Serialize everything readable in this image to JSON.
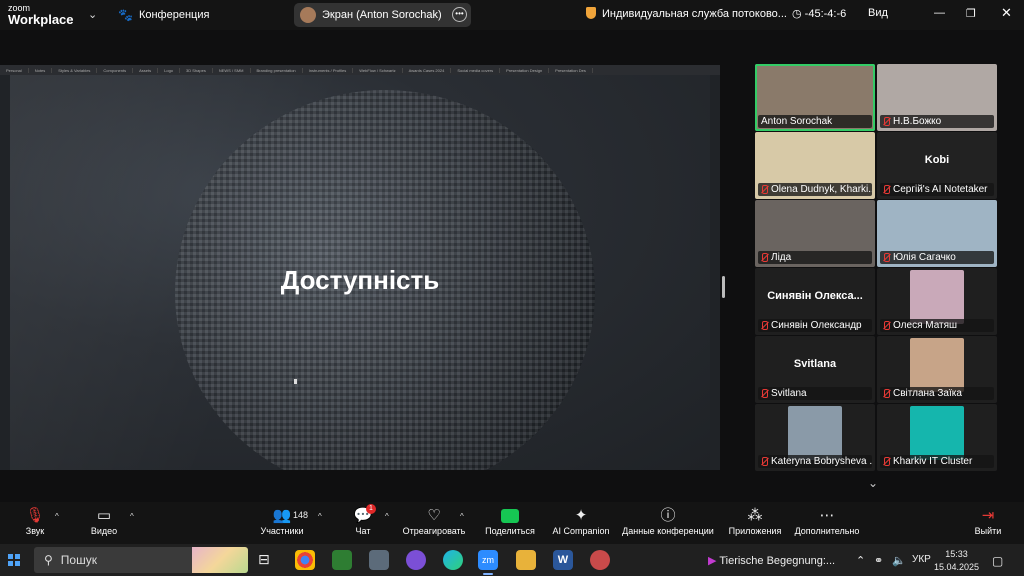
{
  "app": {
    "logo_line1": "zoom",
    "logo_line2": "Workplace",
    "meeting_label": "Конференция"
  },
  "share_indicator": {
    "label": "Экран (Anton Sorochak)"
  },
  "topbar_right": {
    "vpn_label": "Индивидуальная служба потоково...",
    "signal": "-45:-4:-6",
    "view_label": "Вид"
  },
  "browser_tabs": [
    "Personal",
    "Notes",
    "Styles & Variables",
    "Components",
    "Assets",
    "Logo",
    "3D Shapes",
    "NEWS / SMM",
    "Branding presentation",
    "Instruments / Profiles",
    "WebFlow / Schwartz",
    "Awards Cases 2024",
    "Social media covers",
    "Presentation Design",
    "Presentation Des"
  ],
  "slide": {
    "title": "Доступність"
  },
  "participants": [
    {
      "name": "Anton Sorochak",
      "active": true,
      "muted": false,
      "bg": "#8a7a6a"
    },
    {
      "name": "Н.В.Божко",
      "muted": true,
      "bg": "#b0a8a4"
    },
    {
      "name": "Olena Dudnyk, Kharki...",
      "muted": true,
      "bg": "#d7c9a7"
    },
    {
      "name": "Сергій's AI Notetaker",
      "muted": true,
      "bg": "#222222",
      "caption": "Kobi"
    },
    {
      "name": "Ліда",
      "muted": true,
      "bg": "#6a6460"
    },
    {
      "name": "Юлія Сагачко",
      "muted": true,
      "bg": "#9fb4c4"
    },
    {
      "name": "Синявін Олександр",
      "muted": true,
      "bg": "#1f1f1f",
      "caption": "Синявін  Олекса..."
    },
    {
      "name": "Олеся Матяш",
      "muted": true,
      "bg": "#1f1f1f",
      "thumb": "#c9a9b9"
    },
    {
      "name": "Svitlana",
      "muted": true,
      "bg": "#1f1f1f",
      "caption": "Svitlana"
    },
    {
      "name": "Світлана Заїка",
      "muted": true,
      "bg": "#1f1f1f",
      "thumb": "#c7a488"
    },
    {
      "name": "Kateryna Bobrysheva ...",
      "muted": true,
      "bg": "#1f1f1f",
      "thumb": "#8a9aa8"
    },
    {
      "name": "Kharkiv IT Cluster",
      "muted": true,
      "bg": "#1f1f1f",
      "thumb": "#15b6ad"
    }
  ],
  "toolbar": {
    "audio": "Звук",
    "video": "Видео",
    "participants": "Участники",
    "participants_count": "148",
    "chat": "Чат",
    "chat_badge": "1",
    "reactions": "Отреагировать",
    "share": "Поделиться",
    "ai": "AI Companion",
    "info": "Данные конференции",
    "apps": "Приложения",
    "more": "Дополнительно",
    "leave": "Выйти"
  },
  "taskbar": {
    "search_placeholder": "Пошук",
    "media_title": "Tierische Begegnung:...",
    "lang": "УКР",
    "time": "15:33",
    "date": "15.04.2025"
  }
}
